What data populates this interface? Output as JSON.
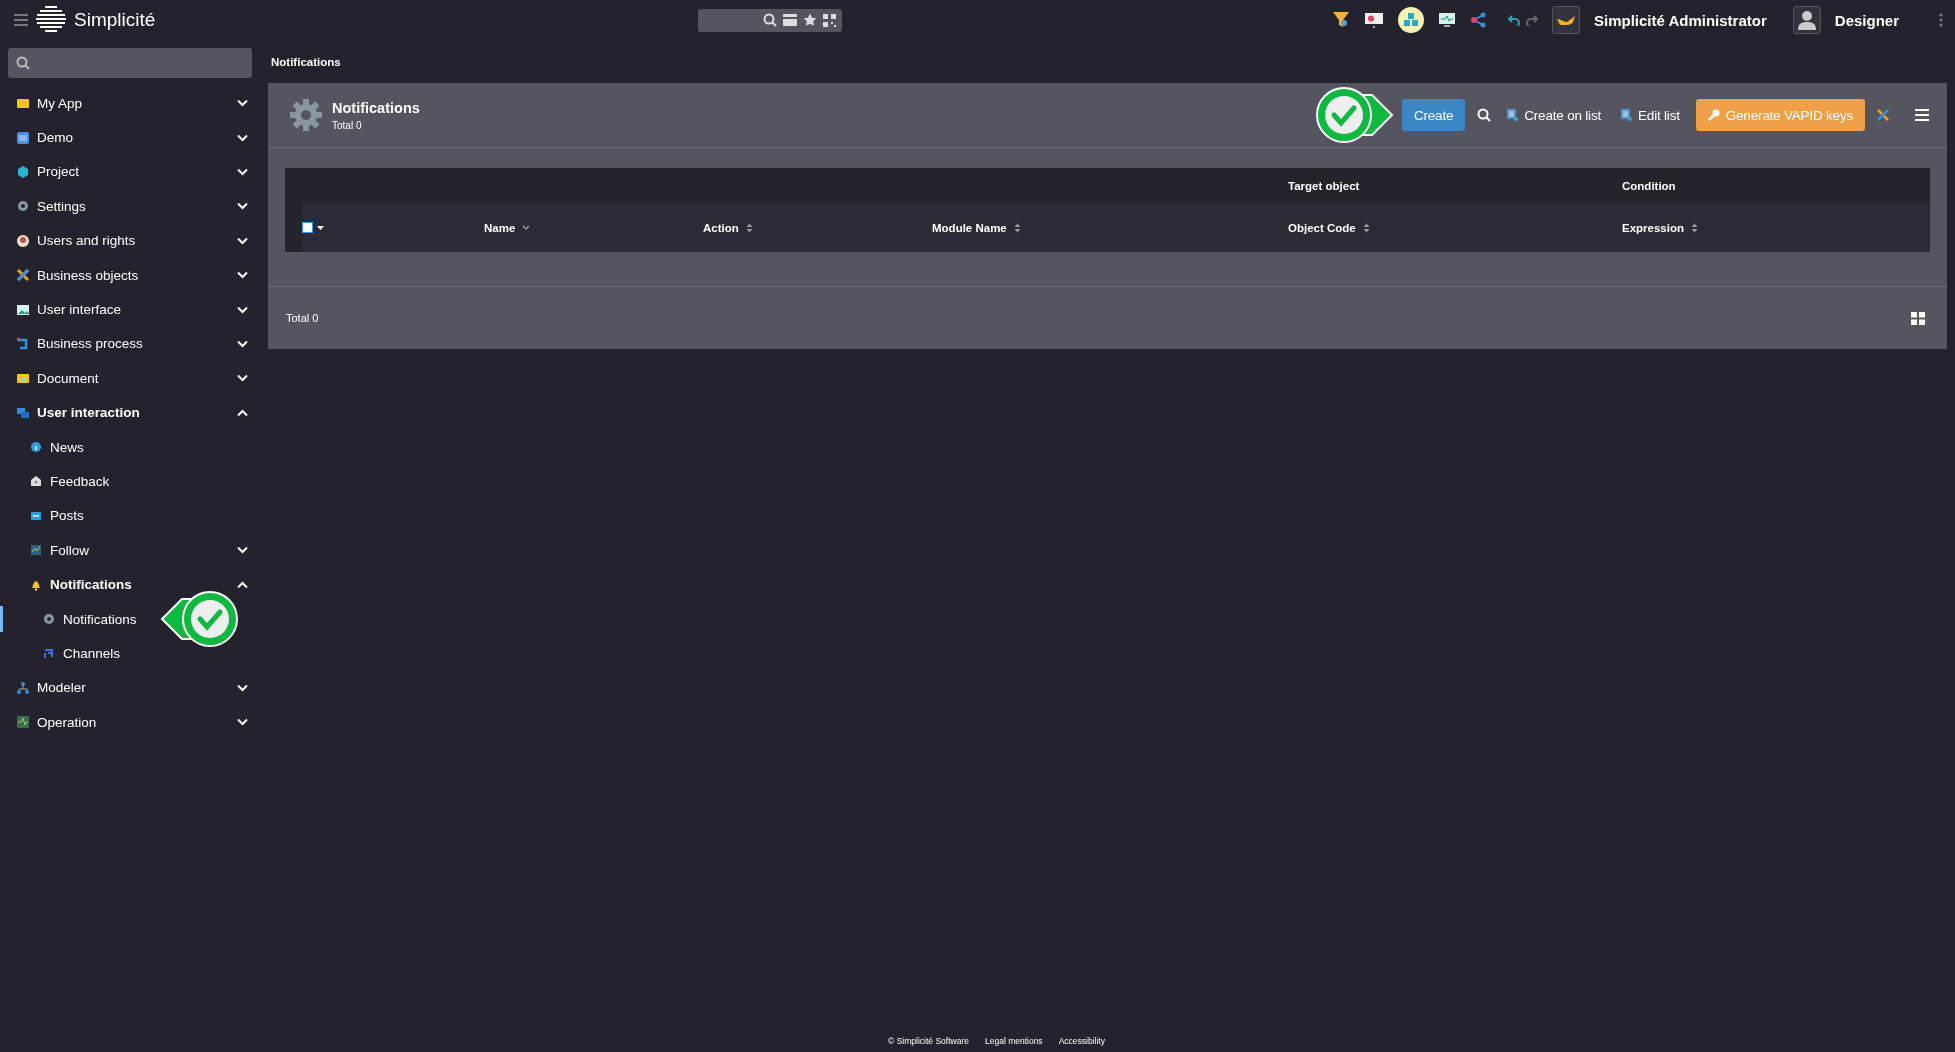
{
  "topbar": {
    "app_name": "Simplicité",
    "user_name": "Simplicité Administrator",
    "profile": "Designer"
  },
  "sidebar": {
    "items": [
      {
        "label": "My App",
        "expanded": false,
        "selected": false
      },
      {
        "label": "Demo",
        "expanded": false,
        "selected": false
      },
      {
        "label": "Project",
        "expanded": false,
        "selected": false
      },
      {
        "label": "Settings",
        "expanded": false,
        "selected": false
      },
      {
        "label": "Users and rights",
        "expanded": false,
        "selected": false
      },
      {
        "label": "Business objects",
        "expanded": false,
        "selected": false
      },
      {
        "label": "User interface",
        "expanded": false,
        "selected": false
      },
      {
        "label": "Business process",
        "expanded": false,
        "selected": false
      },
      {
        "label": "Document",
        "expanded": false,
        "selected": false
      },
      {
        "label": "User interaction",
        "expanded": true,
        "selected": false,
        "children": [
          {
            "label": "News",
            "selected": false
          },
          {
            "label": "Feedback",
            "selected": false
          },
          {
            "label": "Posts",
            "selected": false
          },
          {
            "label": "Follow",
            "expanded": false,
            "selected": false
          },
          {
            "label": "Notifications",
            "expanded": true,
            "selected": false,
            "children": [
              {
                "label": "Notifications",
                "selected": true
              },
              {
                "label": "Channels",
                "selected": false
              }
            ]
          }
        ]
      },
      {
        "label": "Modeler",
        "expanded": false,
        "selected": false
      },
      {
        "label": "Operation",
        "expanded": false,
        "selected": false
      }
    ]
  },
  "breadcrumb": "Notifications",
  "panel": {
    "title": "Notifications",
    "subtitle": "Total 0",
    "actions": [
      {
        "label": "Create",
        "kind": "primary"
      },
      {
        "kind": "search"
      },
      {
        "label": "Create on list",
        "kind": "link"
      },
      {
        "label": "Edit list",
        "kind": "link"
      },
      {
        "label": "Generate VAPID keys",
        "kind": "warning"
      },
      {
        "kind": "tool"
      },
      {
        "kind": "menu"
      }
    ],
    "table": {
      "select_all": {
        "checked": false
      },
      "columns": [
        {
          "label": "Name",
          "sorted": true
        },
        {
          "label": "Action",
          "sorted": false
        },
        {
          "label": "Module Name",
          "sorted": false
        },
        {
          "label": "Object Code",
          "sorted": false,
          "group": "Target object"
        },
        {
          "label": "Expression",
          "sorted": false,
          "group": "Condition"
        }
      ]
    },
    "total": "Total 0"
  },
  "footer": {
    "links": [
      "© Simplicité Software",
      "Legal mentions",
      "Accessibility"
    ]
  }
}
